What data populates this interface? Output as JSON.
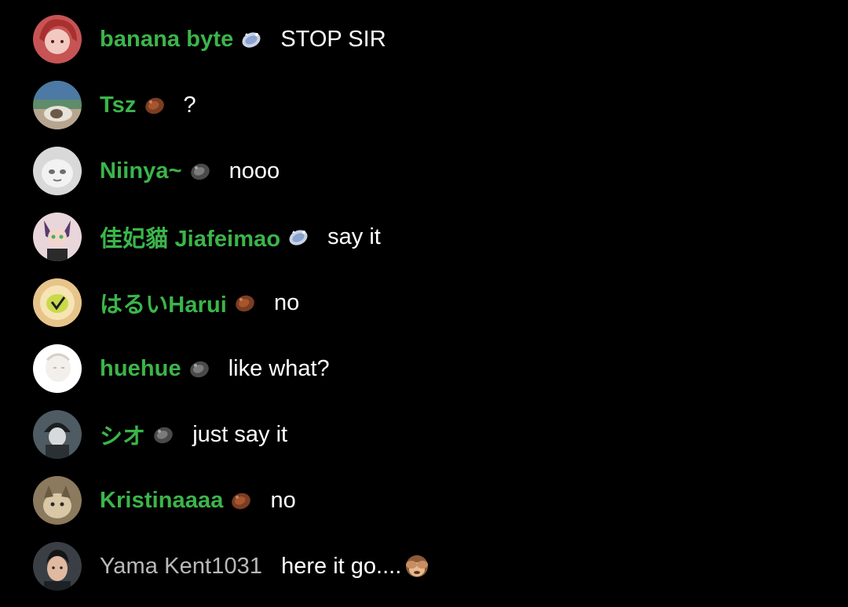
{
  "chat": {
    "messages": [
      {
        "username": "banana byte",
        "badge": "crystal-badge-icon",
        "text": "STOP SIR"
      },
      {
        "username": "Tsz",
        "badge": "brown-badge-icon",
        "text": "?"
      },
      {
        "username": "Niinya~",
        "badge": "gray-badge-icon",
        "text": "nooo"
      },
      {
        "username": "佳妃貓 Jiafeimao",
        "badge": "crystal-badge-icon",
        "text": "say it"
      },
      {
        "username": "はるいHarui",
        "badge": "brown-badge-icon",
        "text": "no"
      },
      {
        "username": "huehue",
        "badge": "gray-badge-icon",
        "text": "like what?"
      },
      {
        "username": "シオ",
        "badge": "gray-badge-icon",
        "text": "just say it"
      },
      {
        "username": "Kristinaaaa",
        "badge": "brown-badge-icon",
        "text": "no"
      },
      {
        "username": "Yama Kent1031",
        "badge": "",
        "text": "here it go....",
        "emoji": "see-no-evil-monkey-icon"
      }
    ]
  },
  "colors": {
    "background": "#000000",
    "username_highlight": "#3bb54a",
    "username_plain": "#b9b9b9",
    "message_text": "#ffffff"
  }
}
